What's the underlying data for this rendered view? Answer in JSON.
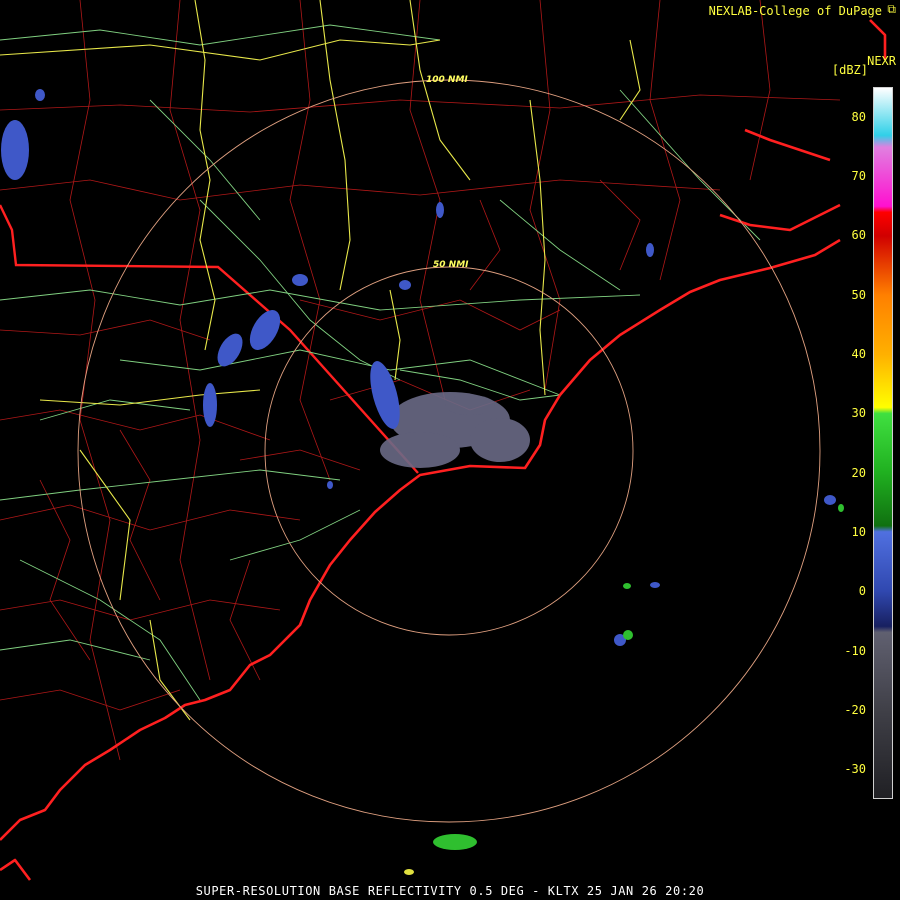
{
  "credit": "NEXLAB-College of DuPage",
  "credit_icon": "restore-window-icon",
  "product": "NEXR",
  "unit": "[dBZ]",
  "footer": "SUPER-RESOLUTION BASE REFLECTIVITY 0.5 DEG - KLTX 25 JAN 26 20:20",
  "rings": [
    {
      "label": "50 NMI"
    },
    {
      "label": "100 NMI"
    }
  ],
  "colorbar": {
    "min_dbz": -35,
    "max_dbz": 85,
    "ticks": [
      80,
      70,
      60,
      50,
      40,
      30,
      20,
      10,
      0,
      -10,
      -20,
      -30
    ]
  },
  "colors": {
    "coastline": "#ff2020",
    "state_border": "#ff2020",
    "county_lines": "#b01818",
    "highways": "#80d080",
    "interstates": "#e8e84a",
    "range_rings": "#e0a080",
    "echo_light": "#6a6a86",
    "echo_blue": "#3f58c8",
    "echo_green": "#2fbf2f"
  },
  "colorbar_stops": [
    {
      "dbz": 85,
      "color": "#ffffff"
    },
    {
      "dbz": 77,
      "color": "#30d0e8"
    },
    {
      "dbz": 75,
      "color": "#e080e0"
    },
    {
      "dbz": 65,
      "color": "#ff10d0"
    },
    {
      "dbz": 64,
      "color": "#ff0000"
    },
    {
      "dbz": 60,
      "color": "#d00000"
    },
    {
      "dbz": 50,
      "color": "#ff8000"
    },
    {
      "dbz": 40,
      "color": "#ffb000"
    },
    {
      "dbz": 31,
      "color": "#ffff00"
    },
    {
      "dbz": 30,
      "color": "#40e040"
    },
    {
      "dbz": 20,
      "color": "#20b020"
    },
    {
      "dbz": 11,
      "color": "#107010"
    },
    {
      "dbz": 10,
      "color": "#5070e0"
    },
    {
      "dbz": 0,
      "color": "#3048b0"
    },
    {
      "dbz": -6,
      "color": "#182060"
    },
    {
      "dbz": -7,
      "color": "#606070"
    },
    {
      "dbz": -20,
      "color": "#404048"
    },
    {
      "dbz": -35,
      "color": "#202024"
    }
  ]
}
